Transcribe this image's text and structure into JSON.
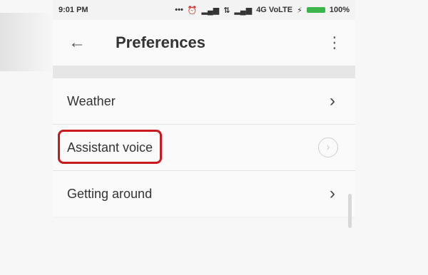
{
  "status": {
    "time": "9:01 PM",
    "network": "4G VoLTE",
    "battery": "100%"
  },
  "header": {
    "title": "Preferences"
  },
  "preferences": {
    "items": [
      {
        "label": "Weather"
      },
      {
        "label": "Assistant voice"
      },
      {
        "label": "Getting around"
      }
    ]
  },
  "icons": {
    "back": "arrow-left-icon",
    "overflow": "more-vert-icon",
    "chevron": "chevron-right-icon"
  },
  "colors": {
    "highlight": "#c9191f"
  }
}
